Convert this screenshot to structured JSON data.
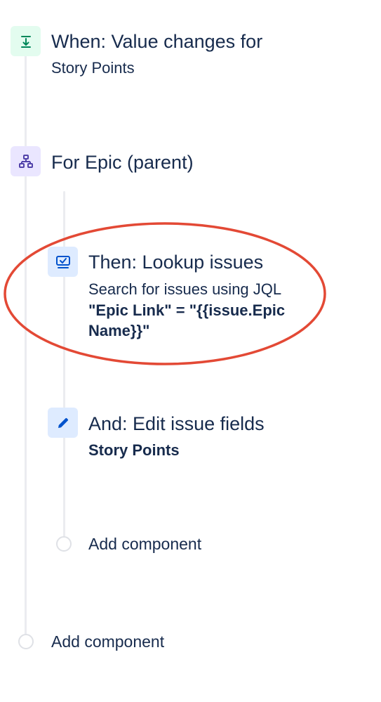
{
  "trigger": {
    "title": "When: Value changes for",
    "field": "Story Points",
    "icon": "trigger-icon"
  },
  "branch": {
    "title": "For Epic (parent)",
    "icon": "branch-icon"
  },
  "lookup": {
    "title": "Then: Lookup issues",
    "description": "Search for issues using JQL",
    "jql_line1": "\"Epic Link\" = \"{{issue.Epic",
    "jql_line2": "Name}}\"",
    "icon": "lookup-issues-icon"
  },
  "edit": {
    "title": "And: Edit issue fields",
    "field": "Story Points",
    "icon": "edit-pencil-icon"
  },
  "add_component_inner": {
    "label": "Add component"
  },
  "add_component_outer": {
    "label": "Add component"
  },
  "colors": {
    "text": "#172b4d",
    "trigger_bg": "#e3fcef",
    "trigger_fg": "#00875a",
    "branch_bg": "#eae6ff",
    "branch_fg": "#5243aa",
    "action_bg": "#deebff",
    "action_fg": "#0052cc",
    "highlight": "#e34935",
    "line": "#ebecf0"
  }
}
